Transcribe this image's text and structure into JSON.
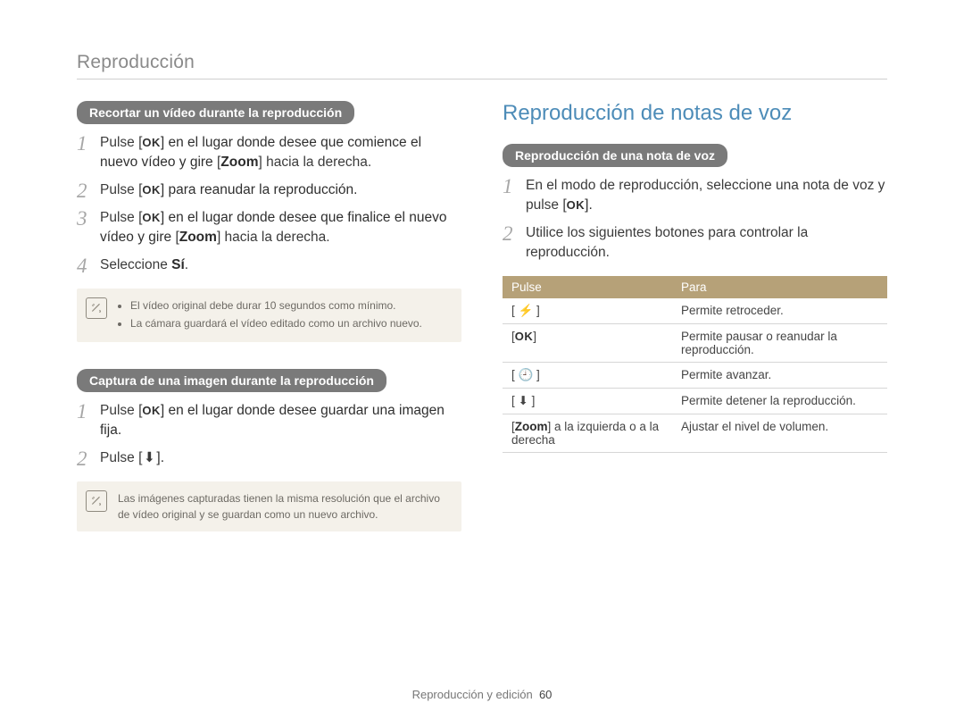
{
  "header": "Reproducción",
  "left": {
    "section1": {
      "pill": "Recortar un vídeo durante la reproducción",
      "steps": [
        {
          "n": "1",
          "pre": "Pulse [",
          "key": "OK",
          "post": "] en el lugar donde desee que comience el nuevo vídeo y gire ",
          "bold": "Zoom",
          "tail": " hacia la derecha."
        },
        {
          "n": "2",
          "pre": "Pulse [",
          "key": "OK",
          "post": "] para reanudar la reproducción."
        },
        {
          "n": "3",
          "pre": "Pulse [",
          "key": "OK",
          "post": "] en el lugar donde desee que finalice el nuevo vídeo y gire ",
          "bold": "Zoom",
          "tail": " hacia la derecha."
        },
        {
          "n": "4",
          "pre": "Seleccione ",
          "bold": "Sí",
          "tail": "."
        }
      ],
      "notes": [
        "El vídeo original debe durar 10 segundos como mínimo.",
        "La cámara guardará el vídeo editado como un archivo nuevo."
      ]
    },
    "section2": {
      "pill": "Captura de una imagen durante la reproducción",
      "steps": [
        {
          "n": "1",
          "pre": "Pulse [",
          "key": "OK",
          "post": "] en el lugar donde desee guardar una imagen fija."
        },
        {
          "n": "2",
          "pre": "Pulse [",
          "glyph": "⬇",
          "post": "]."
        }
      ],
      "note_single": "Las imágenes capturadas tienen la misma resolución que el archivo de vídeo original y se guardan como un nuevo archivo."
    }
  },
  "right": {
    "title": "Reproducción de notas de voz",
    "pill": "Reproducción de una nota de voz",
    "steps": [
      {
        "n": "1",
        "pre": "En el modo de reproducción, seleccione una nota de voz y pulse [",
        "key": "OK",
        "post": "]."
      },
      {
        "n": "2",
        "pre": "Utilice los siguientes botones para controlar la reproducción."
      }
    ],
    "table": {
      "headers": {
        "c1": "Pulse",
        "c2": "Para"
      },
      "rows": [
        {
          "key": "[ ⚡ ]",
          "desc": "Permite retroceder."
        },
        {
          "key": "[ OK ]",
          "desc": "Permite pausar o reanudar la reproducción.",
          "is_ok": true
        },
        {
          "key": "[ 🕘 ]",
          "desc": "Permite avanzar."
        },
        {
          "key": "[ ⬇ ]",
          "desc": "Permite detener la reproducción."
        },
        {
          "key_pre": "[",
          "key_bold": "Zoom",
          "key_post": "] a la izquierda o a la derecha",
          "desc": "Ajustar el nivel de volumen."
        }
      ]
    }
  },
  "footer": {
    "label": "Reproducción y edición",
    "page": "60"
  }
}
